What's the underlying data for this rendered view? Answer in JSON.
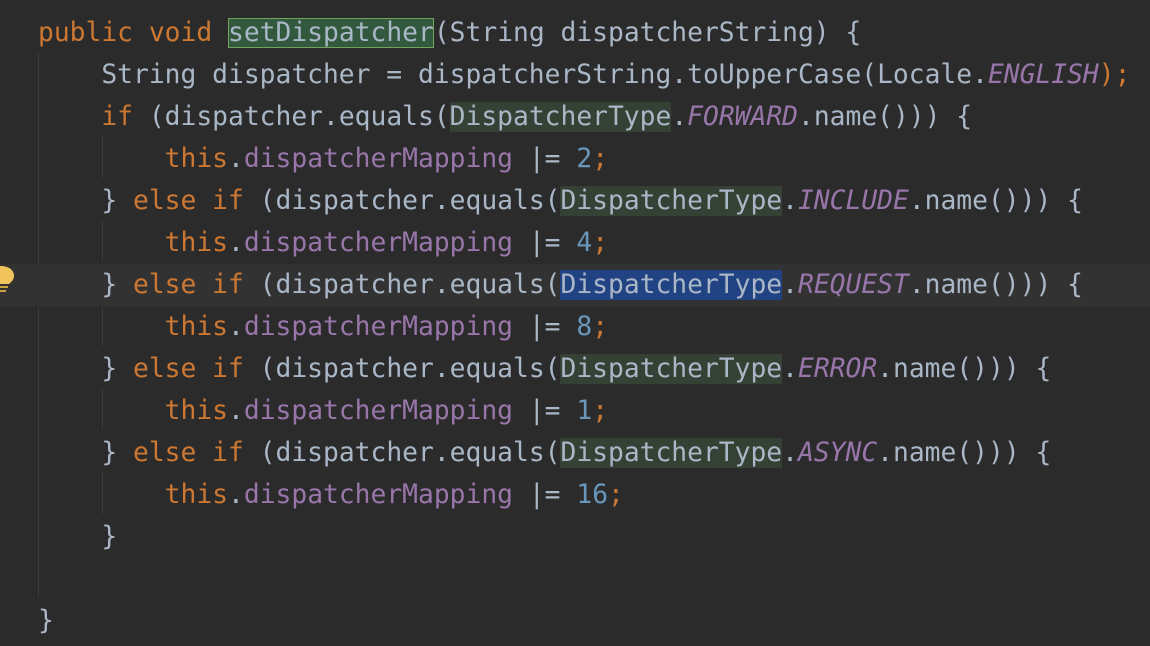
{
  "editor": {
    "lines": [
      [
        {
          "t": "public ",
          "c": "kw"
        },
        {
          "t": "void ",
          "c": "kw"
        },
        {
          "t": "setDispatcher",
          "c": "plain",
          "h": "method"
        },
        {
          "t": "(String dispatcherString) {",
          "c": "plain"
        }
      ],
      [
        {
          "t": "    String dispatcher = dispatcherString.toUpperCase(Locale.",
          "c": "plain"
        },
        {
          "t": "ENGLISH",
          "c": "static"
        },
        {
          "t": ");",
          "c": "kw"
        }
      ],
      [
        {
          "t": "    ",
          "c": "plain"
        },
        {
          "t": "if ",
          "c": "kw"
        },
        {
          "t": "(dispatcher.equals(",
          "c": "plain"
        },
        {
          "t": "DispatcherType",
          "c": "plain",
          "h": "usage"
        },
        {
          "t": ".",
          "c": "plain"
        },
        {
          "t": "FORWARD",
          "c": "static"
        },
        {
          "t": ".name())) {",
          "c": "plain"
        }
      ],
      [
        {
          "t": "        ",
          "c": "plain"
        },
        {
          "t": "this",
          "c": "kw"
        },
        {
          "t": ".",
          "c": "plain"
        },
        {
          "t": "dispatcherMapping",
          "c": "field"
        },
        {
          "t": " |= ",
          "c": "plain"
        },
        {
          "t": "2",
          "c": "num"
        },
        {
          "t": ";",
          "c": "kw"
        }
      ],
      [
        {
          "t": "    } ",
          "c": "plain"
        },
        {
          "t": "else if ",
          "c": "kw"
        },
        {
          "t": "(dispatcher.equals(",
          "c": "plain"
        },
        {
          "t": "DispatcherType",
          "c": "plain",
          "h": "usage"
        },
        {
          "t": ".",
          "c": "plain"
        },
        {
          "t": "INCLUDE",
          "c": "static"
        },
        {
          "t": ".name())) {",
          "c": "plain"
        }
      ],
      [
        {
          "t": "        ",
          "c": "plain"
        },
        {
          "t": "this",
          "c": "kw"
        },
        {
          "t": ".",
          "c": "plain"
        },
        {
          "t": "dispatcherMapping",
          "c": "field"
        },
        {
          "t": " |= ",
          "c": "plain"
        },
        {
          "t": "4",
          "c": "num"
        },
        {
          "t": ";",
          "c": "kw"
        }
      ],
      [
        {
          "t": "    } ",
          "c": "plain"
        },
        {
          "t": "else if ",
          "c": "kw"
        },
        {
          "t": "(dispatcher.equals(",
          "c": "plain"
        },
        {
          "t": "DispatcherType",
          "c": "plain",
          "h": "caret"
        },
        {
          "t": ".",
          "c": "plain"
        },
        {
          "t": "REQUEST",
          "c": "static"
        },
        {
          "t": ".name())) {",
          "c": "plain"
        }
      ],
      [
        {
          "t": "        ",
          "c": "plain"
        },
        {
          "t": "this",
          "c": "kw"
        },
        {
          "t": ".",
          "c": "plain"
        },
        {
          "t": "dispatcherMapping",
          "c": "field"
        },
        {
          "t": " |= ",
          "c": "plain"
        },
        {
          "t": "8",
          "c": "num"
        },
        {
          "t": ";",
          "c": "kw"
        }
      ],
      [
        {
          "t": "    } ",
          "c": "plain"
        },
        {
          "t": "else if ",
          "c": "kw"
        },
        {
          "t": "(dispatcher.equals(",
          "c": "plain"
        },
        {
          "t": "DispatcherType",
          "c": "plain",
          "h": "usage"
        },
        {
          "t": ".",
          "c": "plain"
        },
        {
          "t": "ERROR",
          "c": "static"
        },
        {
          "t": ".name())) {",
          "c": "plain"
        }
      ],
      [
        {
          "t": "        ",
          "c": "plain"
        },
        {
          "t": "this",
          "c": "kw"
        },
        {
          "t": ".",
          "c": "plain"
        },
        {
          "t": "dispatcherMapping",
          "c": "field"
        },
        {
          "t": " |= ",
          "c": "plain"
        },
        {
          "t": "1",
          "c": "num"
        },
        {
          "t": ";",
          "c": "kw"
        }
      ],
      [
        {
          "t": "    } ",
          "c": "plain"
        },
        {
          "t": "else if ",
          "c": "kw"
        },
        {
          "t": "(dispatcher.equals(",
          "c": "plain"
        },
        {
          "t": "DispatcherType",
          "c": "plain",
          "h": "usage"
        },
        {
          "t": ".",
          "c": "plain"
        },
        {
          "t": "ASYNC",
          "c": "static"
        },
        {
          "t": ".name())) {",
          "c": "plain"
        }
      ],
      [
        {
          "t": "        ",
          "c": "plain"
        },
        {
          "t": "this",
          "c": "kw"
        },
        {
          "t": ".",
          "c": "plain"
        },
        {
          "t": "dispatcherMapping",
          "c": "field"
        },
        {
          "t": " |= ",
          "c": "plain"
        },
        {
          "t": "16",
          "c": "num"
        },
        {
          "t": ";",
          "c": "kw"
        }
      ],
      [
        {
          "t": "    }",
          "c": "plain"
        }
      ],
      [],
      [
        {
          "t": "}",
          "c": "plain"
        }
      ]
    ],
    "current_line": 6,
    "gutter_icon": "lightbulb-icon"
  },
  "colors": {
    "background": "#2b2b2b",
    "current_line": "#323232",
    "keyword": "#cc7832",
    "number": "#6897bb",
    "field": "#9876aa",
    "identifier": "#a9b7c6",
    "usage_highlight": "#344134",
    "caret_highlight": "#214283",
    "lightbulb": "#f2c55c"
  }
}
